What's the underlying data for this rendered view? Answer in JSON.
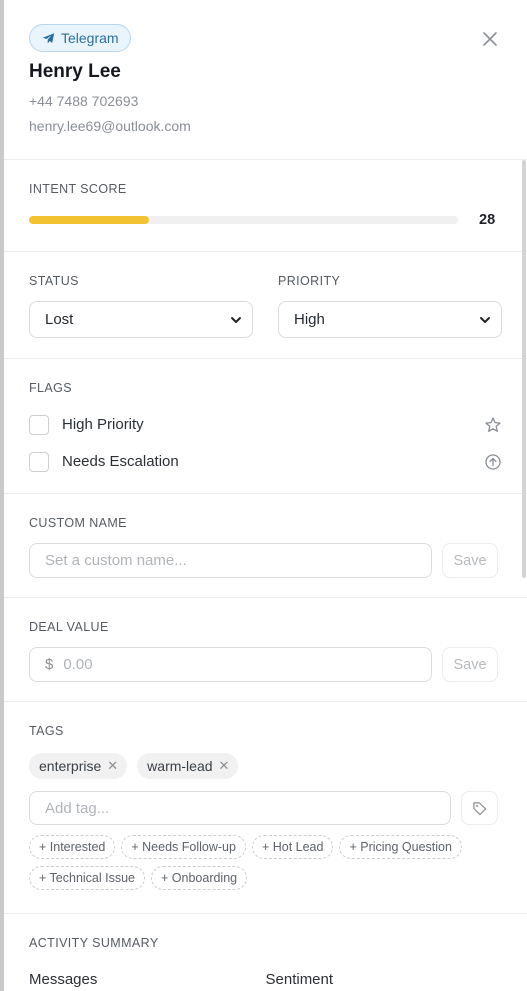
{
  "header": {
    "channel": "Telegram",
    "channel_icon": "telegram-plane-icon",
    "name": "Henry Lee",
    "phone": "+44 7488 702693",
    "email": "henry.lee69@outlook.com"
  },
  "intent": {
    "title": "INTENT SCORE",
    "score": "28",
    "score_fraction": 0.28,
    "bar_color": "#f2c230"
  },
  "status": {
    "title": "STATUS",
    "value": "Lost"
  },
  "priority": {
    "title": "PRIORITY",
    "value": "High"
  },
  "flags": {
    "title": "FLAGS",
    "items": [
      {
        "label": "High Priority",
        "icon": "star-icon",
        "checked": false
      },
      {
        "label": "Needs Escalation",
        "icon": "arrow-up-circle-icon",
        "checked": false
      }
    ]
  },
  "custom_name": {
    "title": "CUSTOM NAME",
    "placeholder": "Set a custom name...",
    "save_label": "Save"
  },
  "deal_value": {
    "title": "DEAL VALUE",
    "currency": "$",
    "placeholder": "0.00",
    "save_label": "Save"
  },
  "tags": {
    "title": "TAGS",
    "items": [
      "enterprise",
      "warm-lead"
    ],
    "add_placeholder": "Add tag...",
    "suggestions": [
      "+ Interested",
      "+ Needs Follow-up",
      "+ Hot Lead",
      "+ Pricing Question",
      "+ Technical Issue",
      "+ Onboarding"
    ]
  },
  "activity": {
    "title": "ACTIVITY SUMMARY",
    "col1": "Messages",
    "col2": "Sentiment"
  },
  "colors": {
    "accent_badge_bg": "#eaf4fc",
    "accent_badge_text": "#2a6f9e"
  }
}
